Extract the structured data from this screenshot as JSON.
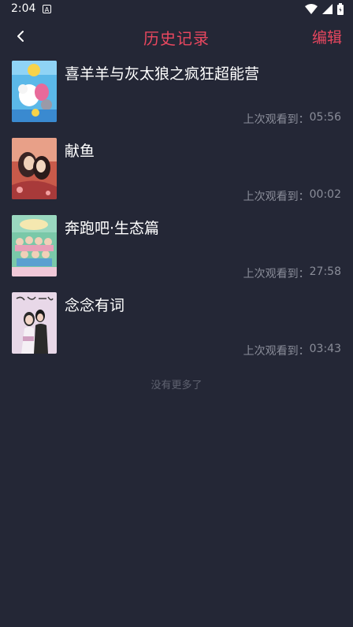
{
  "status_bar": {
    "time": "2:04",
    "notification_letter": "A"
  },
  "header": {
    "title": "历史记录",
    "edit_label": "编辑"
  },
  "history": [
    {
      "title": "喜羊羊与灰太狼之疯狂超能营",
      "progress_label": "上次观看到：",
      "progress_time": "05:56",
      "poster_colors": [
        "#5bb8e8",
        "#f7d34a",
        "#e86a9a",
        "#ffffff"
      ]
    },
    {
      "title": "献鱼",
      "progress_label": "上次观看到：",
      "progress_time": "00:02",
      "poster_colors": [
        "#c85a4a",
        "#e8c9a8",
        "#5a3a3a",
        "#f2a0a0"
      ]
    },
    {
      "title": "奔跑吧·生态篇",
      "progress_label": "上次观看到：",
      "progress_time": "27:58",
      "poster_colors": [
        "#7ac8a8",
        "#f5e8b0",
        "#e8a0b8",
        "#5aa0d0"
      ]
    },
    {
      "title": "念念有词",
      "progress_label": "上次观看到：",
      "progress_time": "03:43",
      "poster_colors": [
        "#e8d8e8",
        "#2a2a2a",
        "#d0a0c0",
        "#f5f0f5"
      ]
    }
  ],
  "footer": {
    "no_more_text": "没有更多了"
  },
  "colors": {
    "background": "#242736",
    "accent": "#e8475f",
    "muted_text": "#8a8d99"
  }
}
